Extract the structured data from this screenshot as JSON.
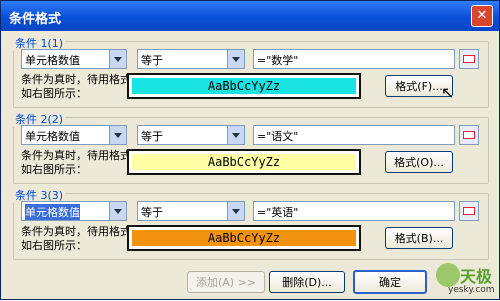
{
  "window": {
    "title": "条件格式"
  },
  "conditions": [
    {
      "label": "条件 1(1)",
      "type": "单元格数值",
      "operator": "等于",
      "value": "=\"数学\"",
      "hint": "条件为真时，待用格式如右图所示：",
      "preview": "AaBbCcYyZz",
      "preview_color": "#19e3e3",
      "format_btn": "格式(F)...",
      "selected_type": false
    },
    {
      "label": "条件 2(2)",
      "type": "单元格数值",
      "operator": "等于",
      "value": "=\"语文\"",
      "hint": "条件为真时，待用格式如右图所示：",
      "preview": "AaBbCcYyZz",
      "preview_color": "#ffffa6",
      "format_btn": "格式(O)...",
      "selected_type": false
    },
    {
      "label": "条件 3(3)",
      "type": "单元格数值",
      "operator": "等于",
      "value": "=\"英语\"",
      "hint": "条件为真时，待用格式如右图所示：",
      "preview": "AaBbCcYyZz",
      "preview_color": "#f2920d",
      "format_btn": "格式(B)...",
      "selected_type": true
    }
  ],
  "footer": {
    "add": "添加(A) >>",
    "delete": "删除(D)...",
    "ok": "确定"
  },
  "watermark": {
    "text1": "天极",
    "text2": "yesky.com"
  }
}
